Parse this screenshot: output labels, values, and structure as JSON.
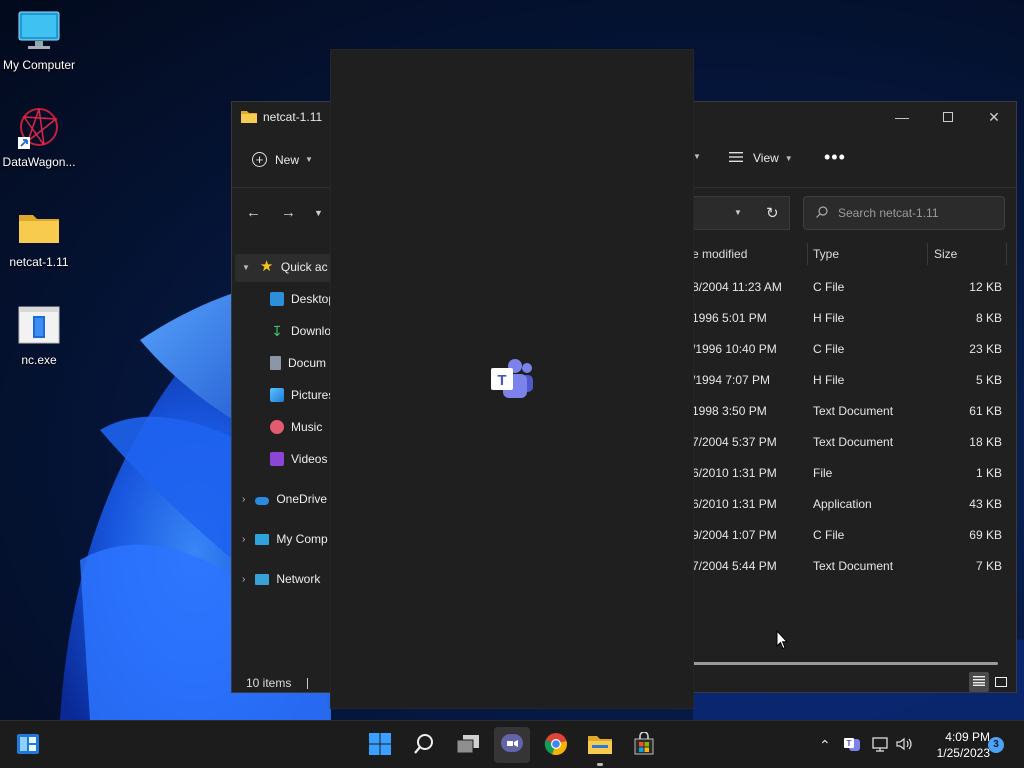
{
  "desktop": {
    "icons": [
      {
        "label": "My Computer"
      },
      {
        "label": "DataWagon..."
      },
      {
        "label": "netcat-1.11"
      },
      {
        "label": "nc.exe"
      }
    ]
  },
  "explorer": {
    "title": "netcat-1.11",
    "toolbar": {
      "new_label": "New",
      "view_label": "View"
    },
    "search_placeholder": "Search netcat-1.11",
    "nav": [
      {
        "label": "Quick ac"
      },
      {
        "label": "Desktop"
      },
      {
        "label": "Downlo"
      },
      {
        "label": "Docum"
      },
      {
        "label": "Pictures"
      },
      {
        "label": "Music"
      },
      {
        "label": "Videos"
      },
      {
        "label": "OneDrive"
      },
      {
        "label": "My Comp"
      },
      {
        "label": "Network"
      }
    ],
    "columns": {
      "modified": "e modified",
      "type": "Type",
      "size": "Size"
    },
    "rows": [
      {
        "modified": "8/2004 11:23 AM",
        "type": "C File",
        "size": "12 KB"
      },
      {
        "modified": "1996 5:01 PM",
        "type": "H File",
        "size": "8 KB"
      },
      {
        "modified": "/1996 10:40 PM",
        "type": "C File",
        "size": "23 KB"
      },
      {
        "modified": "/1994 7:07 PM",
        "type": "H File",
        "size": "5 KB"
      },
      {
        "modified": "1998 3:50 PM",
        "type": "Text Document",
        "size": "61 KB"
      },
      {
        "modified": "7/2004 5:37 PM",
        "type": "Text Document",
        "size": "18 KB"
      },
      {
        "modified": "6/2010 1:31 PM",
        "type": "File",
        "size": "1 KB"
      },
      {
        "modified": "6/2010 1:31 PM",
        "type": "Application",
        "size": "43 KB"
      },
      {
        "modified": "9/2004 1:07 PM",
        "type": "C File",
        "size": "69 KB"
      },
      {
        "modified": "7/2004 5:44 PM",
        "type": "Text Document",
        "size": "7 KB"
      }
    ],
    "status": "10 items"
  },
  "taskbar": {
    "time": "4:09 PM",
    "date": "1/25/2023",
    "notification_count": "3"
  },
  "colors": {
    "accent": "#0067c0",
    "teams": "#5b5fc7",
    "folder": "#f4c542"
  }
}
